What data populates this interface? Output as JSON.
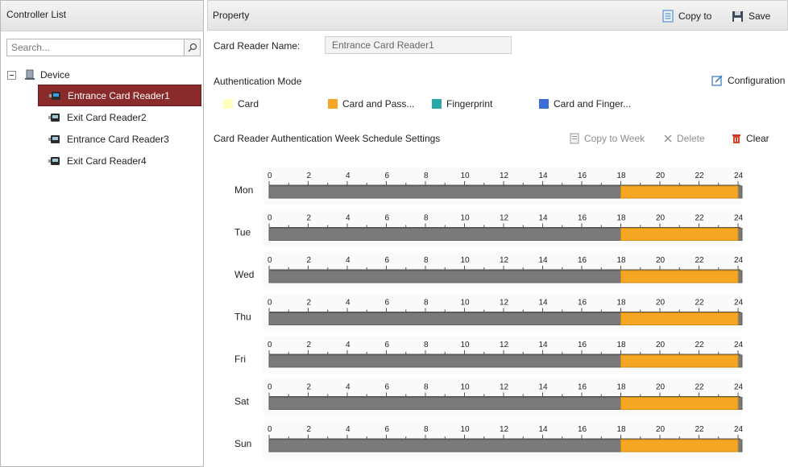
{
  "controller_list": {
    "title": "Controller List",
    "search_placeholder": "Search...",
    "root_label": "Device",
    "items": [
      {
        "label": "Entrance Card Reader1",
        "selected": true
      },
      {
        "label": "Exit Card Reader2",
        "selected": false
      },
      {
        "label": "Entrance Card Reader3",
        "selected": false
      },
      {
        "label": "Exit Card Reader4",
        "selected": false
      }
    ]
  },
  "property": {
    "title": "Property",
    "copy_to_label": "Copy to",
    "save_label": "Save",
    "card_reader_name_label": "Card Reader Name:",
    "card_reader_name_value": "Entrance Card Reader1",
    "auth_mode_label": "Authentication Mode",
    "configuration_label": "Configuration",
    "legend": [
      {
        "label": "Card",
        "color": "#ffffc0"
      },
      {
        "label": "Card and Pass...",
        "color": "#f5a623"
      },
      {
        "label": "Fingerprint",
        "color": "#2aa8a8"
      },
      {
        "label": "Card and Finger...",
        "color": "#3a6fd8"
      }
    ],
    "schedule_title": "Card Reader Authentication Week Schedule Settings",
    "copy_to_week_label": "Copy to Week",
    "delete_label": "Delete",
    "clear_label": "Clear"
  },
  "schedule": {
    "tick_labels": [
      "0",
      "2",
      "4",
      "6",
      "8",
      "10",
      "12",
      "14",
      "16",
      "18",
      "20",
      "22",
      "24"
    ],
    "bar_color": "#7a7a7a",
    "segment_color": "#f5a623",
    "days": [
      {
        "name": "Mon",
        "segments": [
          {
            "start": 18,
            "end": 24
          }
        ]
      },
      {
        "name": "Tue",
        "segments": [
          {
            "start": 18,
            "end": 24
          }
        ]
      },
      {
        "name": "Wed",
        "segments": [
          {
            "start": 18,
            "end": 24
          }
        ]
      },
      {
        "name": "Thu",
        "segments": [
          {
            "start": 18,
            "end": 24
          }
        ]
      },
      {
        "name": "Fri",
        "segments": [
          {
            "start": 18,
            "end": 24
          }
        ]
      },
      {
        "name": "Sat",
        "segments": [
          {
            "start": 18,
            "end": 24
          }
        ]
      },
      {
        "name": "Sun",
        "segments": [
          {
            "start": 18,
            "end": 24
          }
        ]
      }
    ]
  }
}
